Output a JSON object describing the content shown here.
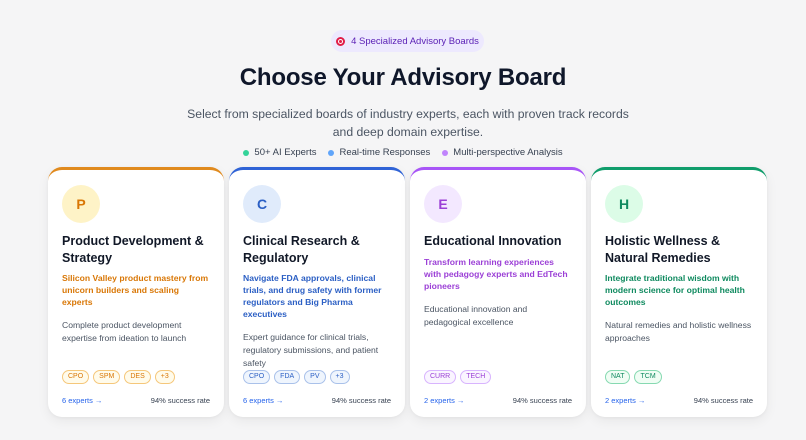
{
  "badge": {
    "label": "4 Specialized Advisory Boards",
    "icon": "target-icon"
  },
  "heading": "Choose Your Advisory Board",
  "subtitle": "Select from specialized boards of industry experts, each with proven track records and deep domain expertise.",
  "features": [
    {
      "label": "50+ AI Experts",
      "color": "#34d399"
    },
    {
      "label": "Real-time Responses",
      "color": "#60a5fa"
    },
    {
      "label": "Multi-perspective Analysis",
      "color": "#c084fc"
    }
  ],
  "boards": [
    {
      "initial": "P",
      "title": "Product Development & Strategy",
      "tagline": "Silicon Valley product mastery from unicorn builders and scaling experts",
      "description": "Complete product development expertise from ideation to launch",
      "tags": [
        "CPO",
        "SPM",
        "DES",
        "+3"
      ],
      "experts_link": "6 experts →",
      "success_rate": "94% success rate",
      "colors": {
        "accent": "#d97706",
        "avatar_bg": "#fef3c7",
        "tag_border": "#f5c77a",
        "tag_bg": "#fffbeb",
        "top": "#e08a1e"
      }
    },
    {
      "initial": "C",
      "title": "Clinical Research & Regulatory",
      "tagline": "Navigate FDA approvals, clinical trials, and drug safety with former regulators and Big Pharma executives",
      "description": "Expert guidance for clinical trials, regulatory submissions, and patient safety",
      "tags": [
        "CPO",
        "FDA",
        "PV",
        "+3"
      ],
      "experts_link": "6 experts →",
      "success_rate": "94% success rate",
      "colors": {
        "accent": "#2b5fc4",
        "avatar_bg": "#e0ebfb",
        "tag_border": "#a9c1ea",
        "tag_bg": "#eff5fd",
        "top": "#2f63d6"
      }
    },
    {
      "initial": "E",
      "title": "Educational Innovation",
      "tagline": "Transform learning experiences with pedagogy experts and EdTech pioneers",
      "description": "Educational innovation and pedagogical excellence",
      "tags": [
        "CURR",
        "TECH"
      ],
      "experts_link": "2 experts →",
      "success_rate": "94% success rate",
      "colors": {
        "accent": "#9b3fd6",
        "avatar_bg": "#f3e8ff",
        "tag_border": "#d8b4fe",
        "tag_bg": "#faf5ff",
        "top": "#a855f7"
      }
    },
    {
      "initial": "H",
      "title": "Holistic Wellness & Natural Remedies",
      "tagline": "Integrate traditional wisdom with modern science for optimal health outcomes",
      "description": "Natural remedies and holistic wellness approaches",
      "tags": [
        "NAT",
        "TCM"
      ],
      "experts_link": "2 experts →",
      "success_rate": "94% success rate",
      "colors": {
        "accent": "#0f8a5f",
        "avatar_bg": "#dcfce7",
        "tag_border": "#86d9b1",
        "tag_bg": "#f0fdf4",
        "top": "#0f9d6b"
      }
    }
  ]
}
